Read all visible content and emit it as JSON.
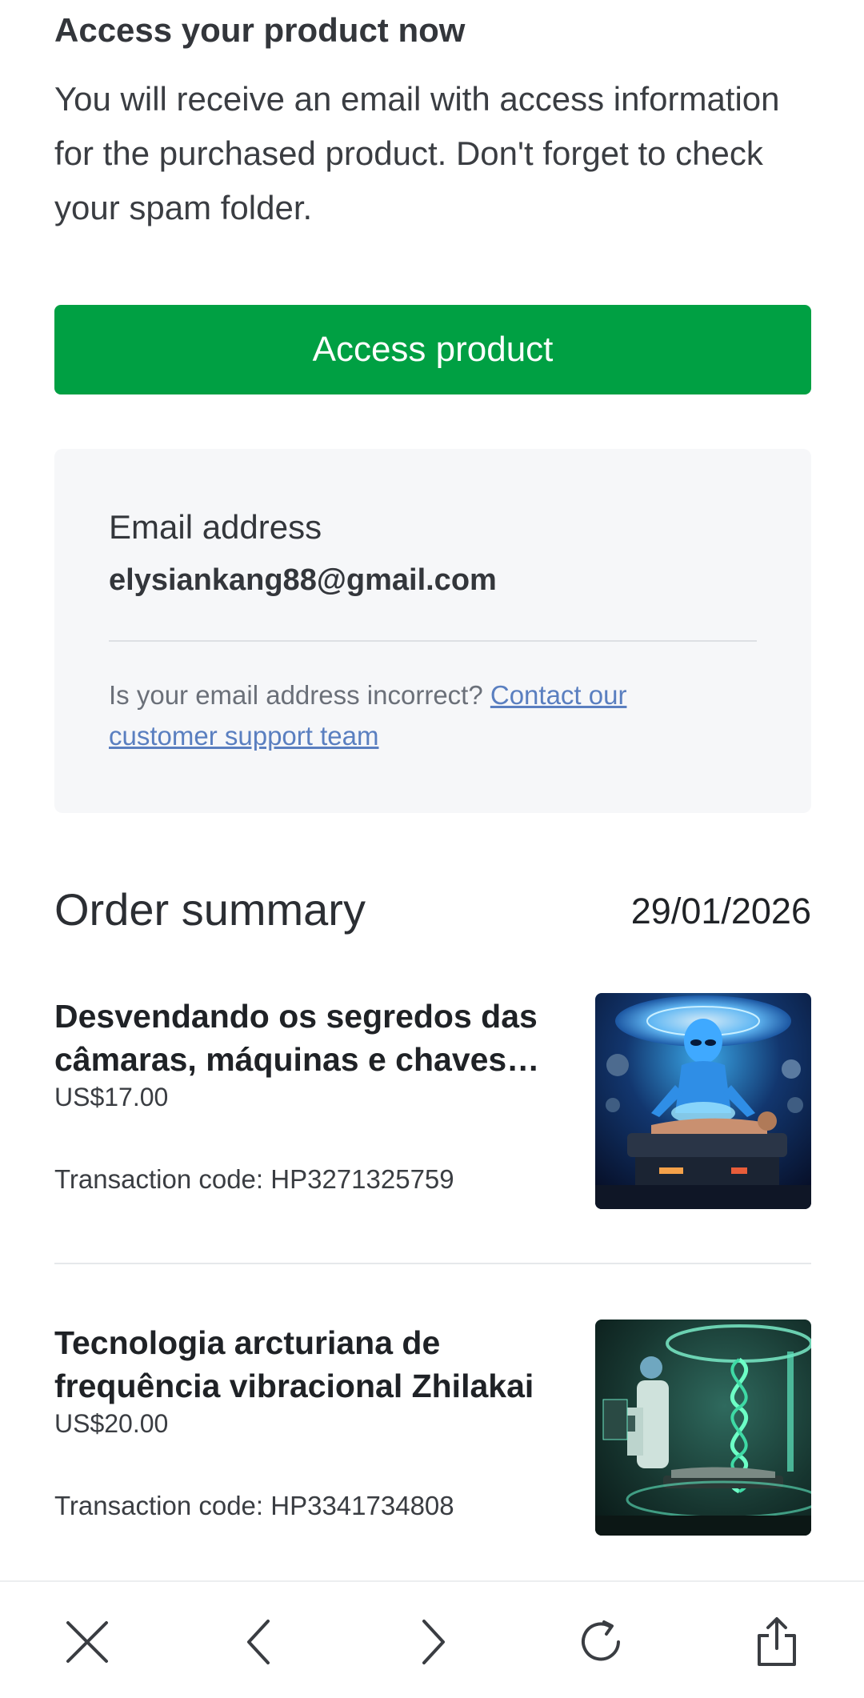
{
  "access": {
    "title": "Access your product now",
    "description": "You will receive an email with access information for the purchased product. Don't forget to check your spam folder.",
    "button_label": "Access product"
  },
  "email_card": {
    "label": "Email address",
    "value": "elysiankang88@gmail.com",
    "help_text": "Is your email address incorrect? ",
    "help_link": "Contact our customer support team"
  },
  "order_summary": {
    "title": "Order summary",
    "date": "29/01/2026",
    "items": [
      {
        "name": "Desvendando os segredos das câmaras, máquinas e chaves…",
        "price": "US$17.00",
        "transaction": "Transaction code: HP3271325759",
        "image": "alien-healing-chamber-image"
      },
      {
        "name": "Tecnologia arcturiana de frequência vibracional Zhilakai",
        "price": "US$20.00",
        "transaction": "Transaction code: HP3341734808",
        "image": "alien-lab-dna-helix-image"
      }
    ]
  },
  "toolbar": {
    "icons": [
      "close-icon",
      "back-icon",
      "forward-icon",
      "reload-icon",
      "share-icon"
    ]
  },
  "colors": {
    "primary_button": "#00a043",
    "card_background": "#f6f7f9",
    "link": "#5a7fc0"
  }
}
